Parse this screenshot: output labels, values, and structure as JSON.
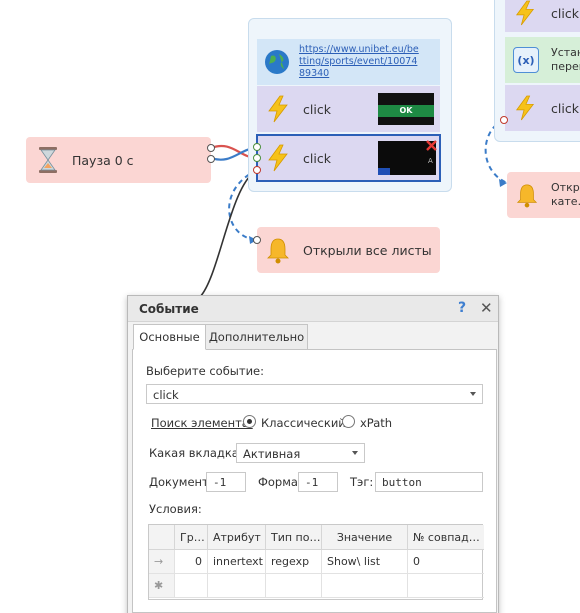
{
  "canvas": {
    "pause_block": {
      "label": "Пауза 0 с"
    },
    "url_block": {
      "label": "https://www.unibet.eu/betting/sports/event/1007489340"
    },
    "click_block_1": {
      "label": "click",
      "thumb_text": "OK"
    },
    "click_block_2": {
      "label": "click",
      "thumb_text": "A"
    },
    "notify_block": {
      "label": "Открыли все листы"
    },
    "right_click_block_1": {
      "label": "click"
    },
    "right_var_block": {
      "label": "Устан… перем…",
      "icon_text": "(x)"
    },
    "right_click_block_2": {
      "label": "click"
    },
    "right_notify_block": {
      "label": "Откр… кате…"
    }
  },
  "dialog": {
    "title": "Событие",
    "help": "?",
    "close": "✕",
    "tabs": [
      {
        "label": "Основные",
        "active": true
      },
      {
        "label": "Дополнительно",
        "active": false
      }
    ],
    "event_label": "Выберите событие:",
    "event_value": "click",
    "search_label": "Поиск элемента:",
    "radio_classic": "Классический",
    "radio_xpath": "xPath",
    "tab_label": "Какая вкладка:",
    "tab_value": "Активная",
    "doc_label": "Документ:",
    "doc_value": "-1",
    "form_label": "Форма:",
    "form_value": "-1",
    "tag_label": "Тэг:",
    "tag_value": "button",
    "conditions_label": "Условия:",
    "table": {
      "headers": [
        "Гр…",
        "Атрибут",
        "Тип по…",
        "Значение",
        "№ совпад…"
      ],
      "rows": [
        {
          "marker": "→",
          "cells": [
            "0",
            "innertext",
            "regexp",
            "Show\\ list",
            "0"
          ]
        },
        {
          "marker": "✱",
          "cells": [
            "",
            "",
            "",
            "",
            ""
          ]
        }
      ]
    }
  },
  "colors": {
    "accent_blue": "#2c5fb7",
    "block_lavender": "#dcd8f1",
    "block_pink": "#fbd6d3",
    "block_blue": "#d3e6f7",
    "block_green": "#d6efd8",
    "link_red": "#d9534f",
    "link_blue": "#3b7cc8"
  }
}
